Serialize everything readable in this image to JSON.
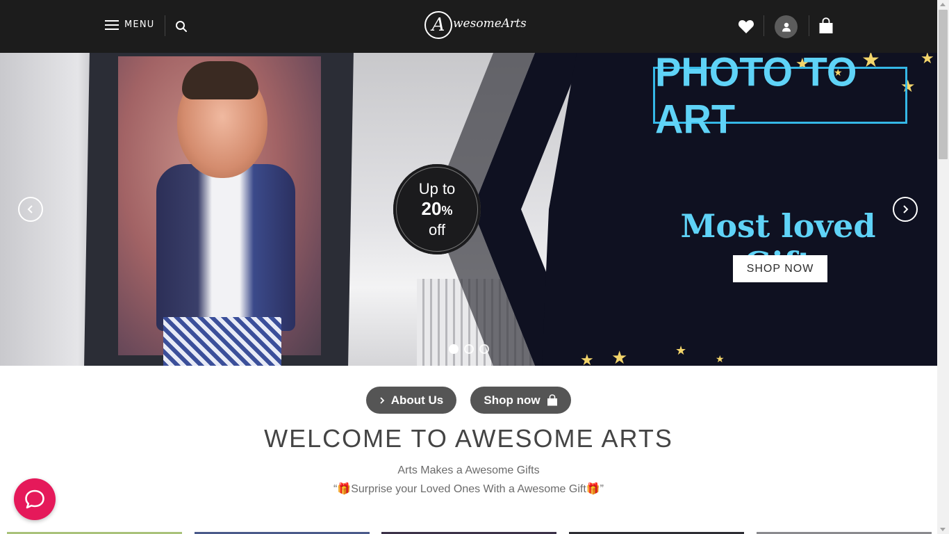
{
  "header": {
    "menu_label": "MENU",
    "logo_mark": "A",
    "logo_text": "wesomeArts",
    "icons": [
      "hamburger-icon",
      "search-icon",
      "heart-icon",
      "user-icon",
      "shopping-bag-icon"
    ]
  },
  "hero": {
    "badge": {
      "line1": "Up to",
      "percent": "20",
      "percent_sign": "%",
      "line3": "off"
    },
    "title": "PHOTO TO ART",
    "subtitle": "Most loved Gift",
    "cta_label": "SHOP NOW",
    "slides_count": 3,
    "active_slide": 1
  },
  "cta": {
    "about_label": "About Us",
    "shop_label": "Shop now"
  },
  "welcome": {
    "heading": "WELCOME TO AWESOME ARTS",
    "tagline": "Arts Makes a Awesome Gifts",
    "quote": "“🎁Surprise your Loved Ones With a Awesome Gift🎁”"
  },
  "colors": {
    "header_bg": "#1c1c1c",
    "hero_accent": "#5fd3f7",
    "pill_bg": "#555555",
    "chat_bg": "#e5195a",
    "star": "#f3d56b"
  }
}
